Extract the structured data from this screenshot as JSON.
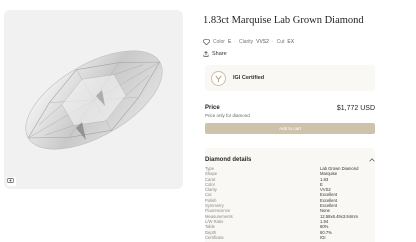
{
  "product": {
    "title": "1.83ct Marquise Lab Grown Diamond",
    "specs": [
      {
        "label": "Color",
        "value": "E"
      },
      {
        "label": "Clarity",
        "value": "VVS2"
      },
      {
        "label": "Cut",
        "value": "EX"
      }
    ],
    "share_label": "Share"
  },
  "certification": {
    "label": "IGI Certified"
  },
  "price": {
    "label": "Price",
    "note": "Price only for diamond",
    "value": "$1,772 USD"
  },
  "cart_button": {
    "label": "Add to cart"
  },
  "details": {
    "title": "Diamond details",
    "rows": [
      {
        "key": "Type",
        "value": "Lab Grown Diamond"
      },
      {
        "key": "Shape",
        "value": "Marquise"
      },
      {
        "key": "Carat",
        "value": "1.83"
      },
      {
        "key": "Color",
        "value": "E"
      },
      {
        "key": "Clarity",
        "value": "VVS2"
      },
      {
        "key": "Cut",
        "value": "Excellent"
      },
      {
        "key": "Polish",
        "value": "Excellent"
      },
      {
        "key": "Symmetry",
        "value": "Excellent"
      },
      {
        "key": "Fluorescence",
        "value": "None"
      },
      {
        "key": "Measurements",
        "value": "12.58x6.49x3.94mm"
      },
      {
        "key": "L/W Ratio",
        "value": "1.94"
      },
      {
        "key": "Table",
        "value": "60%"
      },
      {
        "key": "Depth",
        "value": "60.7%"
      },
      {
        "key": "Certificate",
        "value": "IGI"
      }
    ]
  },
  "icons": {
    "zoom": "zoom-icon",
    "diamond": "diamond-icon",
    "share": "share-icon",
    "igi": "igi-logo",
    "chevron": "chevron-up-icon"
  },
  "colors": {
    "button": "#cfc2ab",
    "panel": "#faf8f4",
    "gallery_bg": "#f1f1f1"
  }
}
